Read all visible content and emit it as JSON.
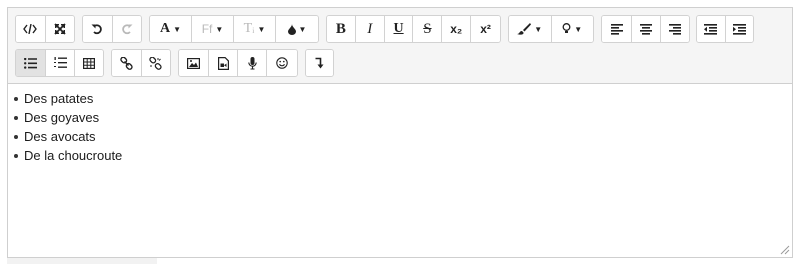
{
  "toolbar": {
    "font_family_label": "Ff",
    "font_size_label": "Tᵢ",
    "bold_label": "B",
    "italic_label": "I",
    "underline_label": "U",
    "strike_label": "S",
    "subscript_label": "x₂",
    "superscript_label": "x²",
    "font_color_label": "A"
  },
  "content": {
    "items": [
      "Des patates",
      "Des goyaves",
      "Des avocats",
      "De la choucroute"
    ]
  }
}
